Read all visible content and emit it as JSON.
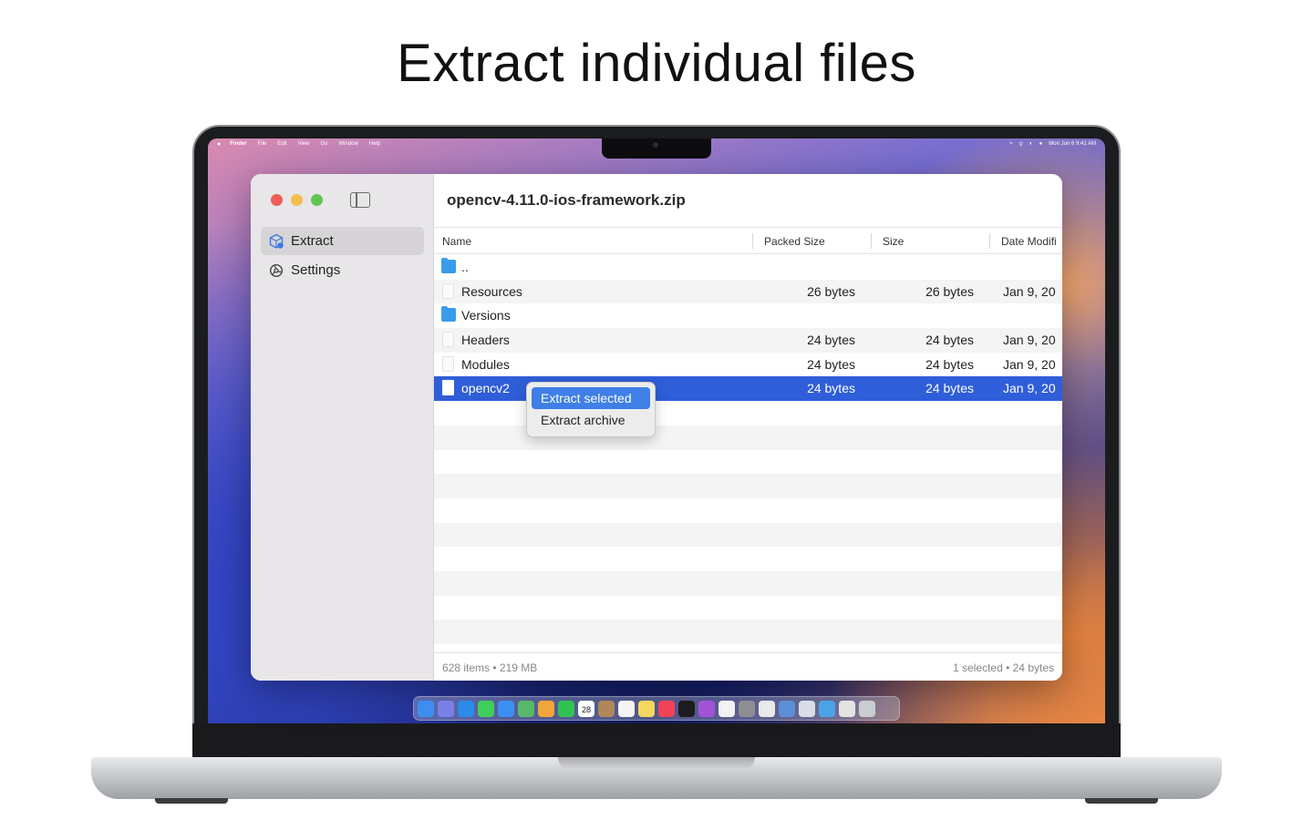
{
  "headline": "Extract individual files",
  "menubar": {
    "app_name": "Finder",
    "menus": [
      "File",
      "Edit",
      "View",
      "Go",
      "Window",
      "Help"
    ],
    "clock": "Mon Jun 6  9:41 AM"
  },
  "sidebar": {
    "items": [
      {
        "label": "Extract",
        "icon": "package-icon",
        "active": true
      },
      {
        "label": "Settings",
        "icon": "gear-icon",
        "active": false
      }
    ]
  },
  "window": {
    "title": "opencv-4.11.0-ios-framework.zip"
  },
  "table": {
    "columns": [
      "Name",
      "Packed Size",
      "Size",
      "Date Modifi"
    ],
    "rows": [
      {
        "name": "..",
        "kind": "folder",
        "packed": "",
        "size": "",
        "date": ""
      },
      {
        "name": "Resources",
        "kind": "file",
        "packed": "26 bytes",
        "size": "26 bytes",
        "date": "Jan 9, 20"
      },
      {
        "name": "Versions",
        "kind": "folder",
        "packed": "",
        "size": "",
        "date": ""
      },
      {
        "name": "Headers",
        "kind": "file",
        "packed": "24 bytes",
        "size": "24 bytes",
        "date": "Jan 9, 20"
      },
      {
        "name": "Modules",
        "kind": "file",
        "packed": "24 bytes",
        "size": "24 bytes",
        "date": "Jan 9, 20"
      },
      {
        "name": "opencv2",
        "kind": "file",
        "packed": "24 bytes",
        "size": "24 bytes",
        "date": "Jan 9, 20",
        "selected": true
      }
    ]
  },
  "context_menu": {
    "items": [
      "Extract selected",
      "Extract archive"
    ]
  },
  "status": {
    "left": "628 items • 219 MB",
    "right": "1 selected • 24 bytes"
  },
  "calendar_day": "28",
  "colors": {
    "accent": "#2f5ed9",
    "menu_highlight": "#3f7fe6",
    "folder": "#3a9ce8",
    "close": "#ee5c55",
    "minimize": "#f3bd4f",
    "zoom": "#61c454"
  },
  "dock_icons": [
    {
      "name": "finder-icon",
      "color": "#3d8ef0"
    },
    {
      "name": "launchpad-icon",
      "color": "#7b7fe8"
    },
    {
      "name": "safari-icon",
      "color": "#2a8ce6"
    },
    {
      "name": "messages-icon",
      "color": "#3fcf5a"
    },
    {
      "name": "mail-icon",
      "color": "#3b8ff2"
    },
    {
      "name": "maps-icon",
      "color": "#59b96b"
    },
    {
      "name": "photos-icon",
      "color": "#f0a63a"
    },
    {
      "name": "facetime-icon",
      "color": "#32c254"
    },
    {
      "name": "calendar-icon",
      "color": "#ffffff"
    },
    {
      "name": "contacts-icon",
      "color": "#b08758"
    },
    {
      "name": "reminders-icon",
      "color": "#f4f4f4"
    },
    {
      "name": "notes-icon",
      "color": "#f6d760"
    },
    {
      "name": "music-icon",
      "color": "#f24257"
    },
    {
      "name": "tv-icon",
      "color": "#1c1c1e"
    },
    {
      "name": "podcasts-icon",
      "color": "#a153d8"
    },
    {
      "name": "news-icon",
      "color": "#f2f2f2"
    },
    {
      "name": "settings-icon",
      "color": "#8e8e93"
    },
    {
      "name": "pages-icon",
      "color": "#e9e9e9"
    },
    {
      "name": "preview-icon",
      "color": "#5b8fd6"
    },
    {
      "name": "app-icon",
      "color": "#d9dde6"
    },
    {
      "name": "folder-icon",
      "color": "#4aa3e9"
    },
    {
      "name": "documents-icon",
      "color": "#e3e3e3"
    },
    {
      "name": "trash-icon",
      "color": "#c9ccd1"
    }
  ]
}
